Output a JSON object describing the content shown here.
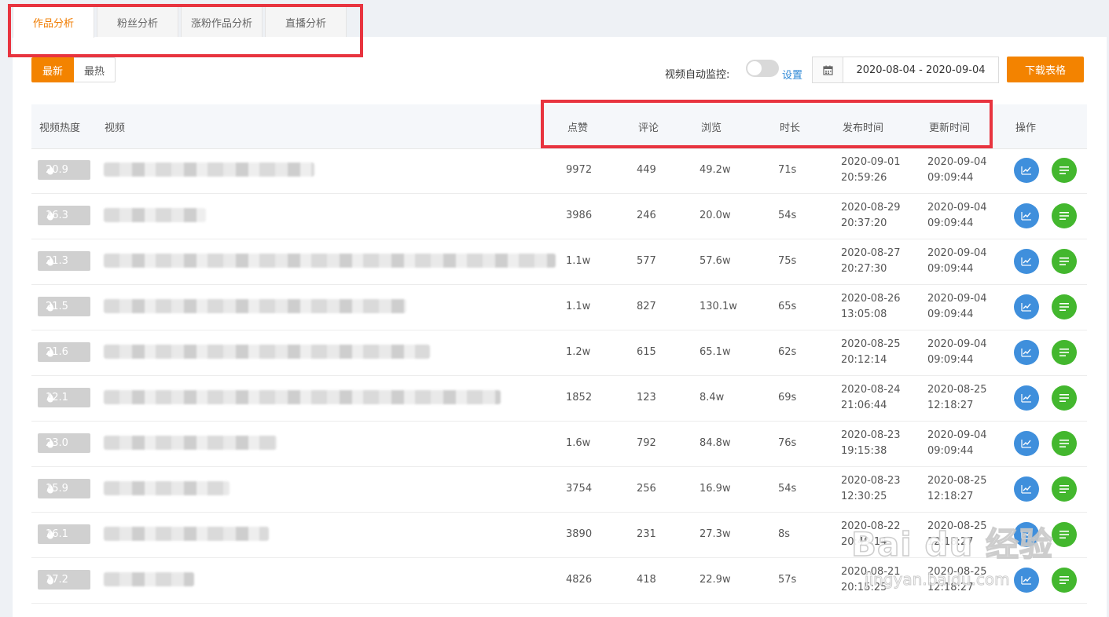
{
  "tabs": [
    "作品分析",
    "粉丝分析",
    "涨粉作品分析",
    "直播分析"
  ],
  "sort_options": [
    "最新",
    "最热"
  ],
  "monitor": {
    "label": "视频自动监控:",
    "settings": "设置"
  },
  "date_range": "2020-08-04 - 2020-09-04",
  "download_label": "下载表格",
  "columns": {
    "heat": "视频热度",
    "video": "视频",
    "likes": "点赞",
    "comments": "评论",
    "views": "浏览",
    "duration": "时长",
    "publish": "发布时间",
    "updated": "更新时间",
    "ops": "操作"
  },
  "rows": [
    {
      "heat": "20.9",
      "likes": "9972",
      "comments": "449",
      "views": "49.2w",
      "duration": "71s",
      "pub_date": "2020-09-01",
      "pub_time": "20:59:26",
      "upd_date": "2020-09-04",
      "upd_time": "09:09:44"
    },
    {
      "heat": "16.3",
      "likes": "3986",
      "comments": "246",
      "views": "20.0w",
      "duration": "54s",
      "pub_date": "2020-08-29",
      "pub_time": "20:37:20",
      "upd_date": "2020-09-04",
      "upd_time": "09:09:44"
    },
    {
      "heat": "21.3",
      "likes": "1.1w",
      "comments": "577",
      "views": "57.6w",
      "duration": "75s",
      "pub_date": "2020-08-27",
      "pub_time": "20:27:30",
      "upd_date": "2020-09-04",
      "upd_time": "09:09:44"
    },
    {
      "heat": "21.5",
      "likes": "1.1w",
      "comments": "827",
      "views": "130.1w",
      "duration": "65s",
      "pub_date": "2020-08-26",
      "pub_time": "13:05:08",
      "upd_date": "2020-09-04",
      "upd_time": "09:09:44"
    },
    {
      "heat": "21.6",
      "likes": "1.2w",
      "comments": "615",
      "views": "65.1w",
      "duration": "62s",
      "pub_date": "2020-08-25",
      "pub_time": "20:12:14",
      "upd_date": "2020-09-04",
      "upd_time": "09:09:44"
    },
    {
      "heat": "12.1",
      "likes": "1852",
      "comments": "123",
      "views": "8.4w",
      "duration": "69s",
      "pub_date": "2020-08-24",
      "pub_time": "21:06:44",
      "upd_date": "2020-08-25",
      "upd_time": "12:18:27"
    },
    {
      "heat": "23.0",
      "likes": "1.6w",
      "comments": "792",
      "views": "84.8w",
      "duration": "76s",
      "pub_date": "2020-08-23",
      "pub_time": "19:15:38",
      "upd_date": "2020-09-04",
      "upd_time": "09:09:44"
    },
    {
      "heat": "15.9",
      "likes": "3754",
      "comments": "256",
      "views": "16.9w",
      "duration": "54s",
      "pub_date": "2020-08-23",
      "pub_time": "12:30:25",
      "upd_date": "2020-08-25",
      "upd_time": "12:18:27"
    },
    {
      "heat": "16.1",
      "likes": "3890",
      "comments": "231",
      "views": "27.3w",
      "duration": "8s",
      "pub_date": "2020-08-22",
      "pub_time": "20:49:14",
      "upd_date": "2020-08-25",
      "upd_time": "12:18:27"
    },
    {
      "heat": "17.2",
      "likes": "4826",
      "comments": "418",
      "views": "22.9w",
      "duration": "57s",
      "pub_date": "2020-08-21",
      "pub_time": "20:15:25",
      "upd_date": "2020-08-25",
      "upd_time": "12:18:27"
    }
  ],
  "watermark": {
    "line1": "Bai du 经验",
    "line2": "jingyan.baidu.com"
  }
}
